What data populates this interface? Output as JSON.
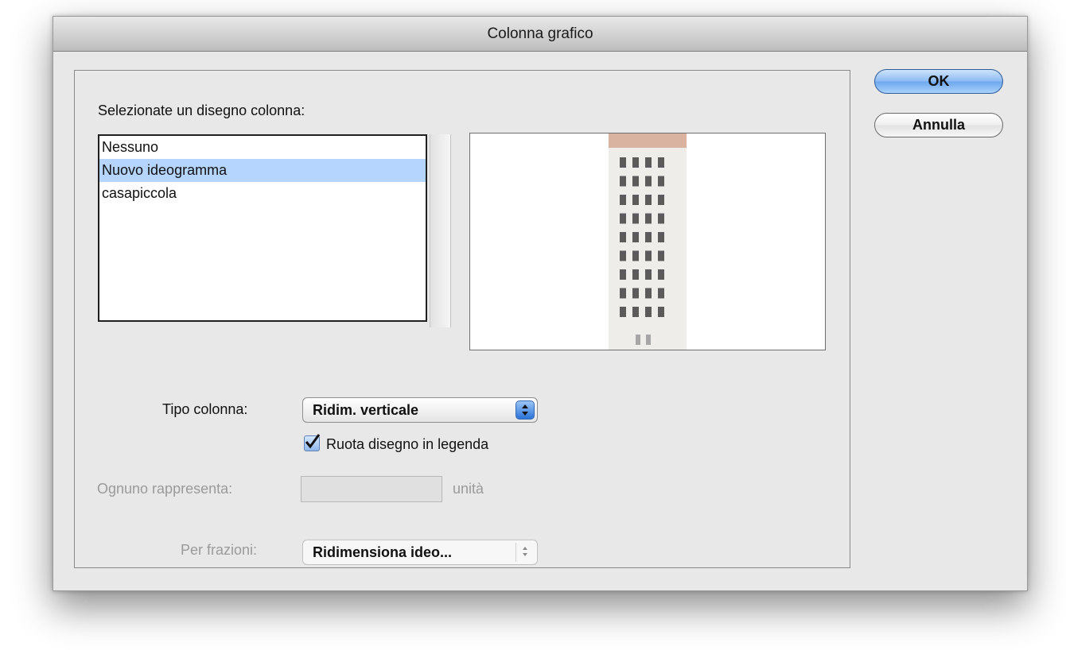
{
  "dialog": {
    "title": "Colonna grafico",
    "ok_label": "OK",
    "cancel_label": "Annulla"
  },
  "design_list": {
    "prompt": "Selezionate un disegno colonna:",
    "items": [
      "Nessuno",
      "Nuovo ideogramma",
      "casapiccola"
    ],
    "selected_index": 1
  },
  "preview": {
    "icon": "building-ideogram-icon",
    "colors": {
      "roof": "#d9b39f",
      "facade": "#efede9",
      "window": "#5b5b5b"
    }
  },
  "column_type": {
    "label": "Tipo colonna:",
    "value": "Ridim. verticale",
    "icon": "updown-arrows-icon"
  },
  "rotate_legend": {
    "label": "Ruota disegno in legenda",
    "checked": true
  },
  "each_represents": {
    "label": "Ognuno rappresenta:",
    "value": "",
    "unit": "unità",
    "enabled": false
  },
  "fractions": {
    "label": "Per frazioni:",
    "value": "Ridimensiona ideo...",
    "enabled": false
  }
}
